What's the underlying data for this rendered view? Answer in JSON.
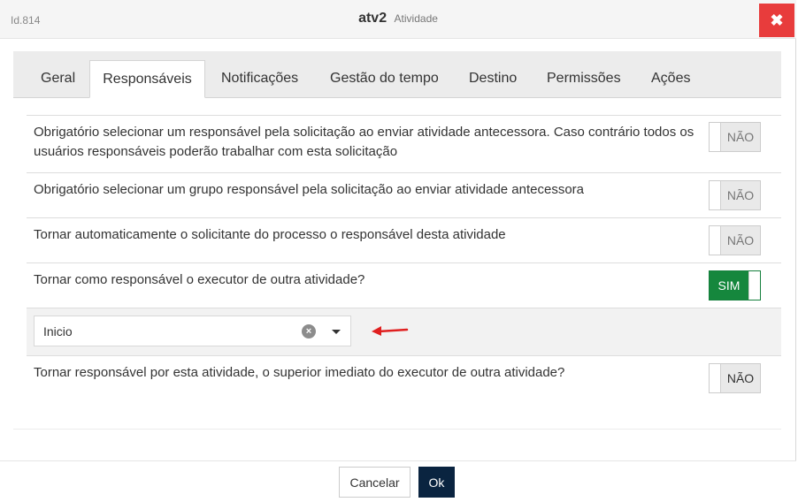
{
  "header": {
    "id_label": "Id.814",
    "title": "atv2",
    "subtitle": "Atividade",
    "close_symbol": "✖"
  },
  "tabs": [
    {
      "label": "Geral",
      "active": false
    },
    {
      "label": "Responsáveis",
      "active": true
    },
    {
      "label": "Notificações",
      "active": false
    },
    {
      "label": "Gestão do tempo",
      "active": false
    },
    {
      "label": "Destino",
      "active": false
    },
    {
      "label": "Permissões",
      "active": false
    },
    {
      "label": "Ações",
      "active": false
    }
  ],
  "settings": [
    {
      "label": "Obrigatório selecionar um responsável pela solicitação ao enviar atividade antecessora. Caso contrário todos os usuários responsáveis poderão trabalhar com esta solicitação",
      "toggle": "NÃO",
      "on": false
    },
    {
      "label": "Obrigatório selecionar um grupo responsável pela solicitação ao enviar atividade antecessora",
      "toggle": "NÃO",
      "on": false
    },
    {
      "label": "Tornar automaticamente o solicitante do processo o responsável desta atividade",
      "toggle": "NÃO",
      "on": false
    },
    {
      "label": "Tornar como responsável o executor de outra atividade?",
      "toggle": "SIM",
      "on": true
    },
    {
      "label": "Tornar responsável por esta atividade, o superior imediato do executor de outra atividade?",
      "toggle": "NÃO",
      "on": false
    }
  ],
  "activity_select": {
    "value": "Inicio",
    "clear_symbol": "×"
  },
  "annotation": {
    "arrow_color": "#e02020"
  },
  "footer": {
    "cancel_label": "Cancelar",
    "ok_label": "Ok"
  },
  "colors": {
    "close_button": "#e83c3c",
    "toggle_on": "#15873d",
    "ok_button": "#0a2440"
  }
}
